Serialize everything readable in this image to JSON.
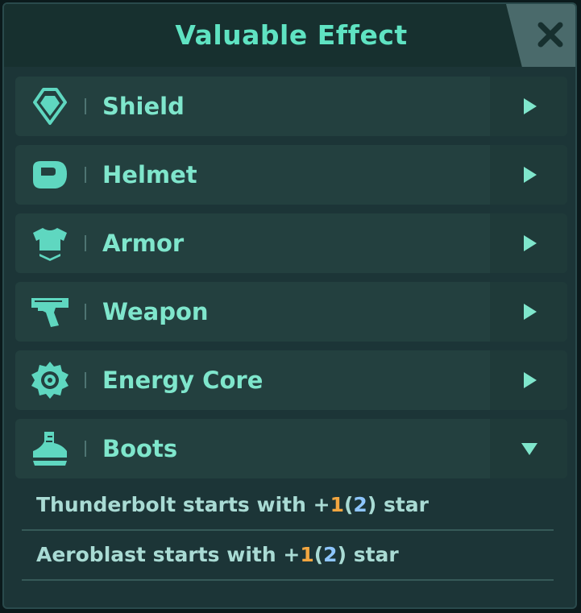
{
  "header": {
    "title": "Valuable Effect"
  },
  "categories": [
    {
      "label": "Shield",
      "icon": "shield-icon",
      "expanded": false
    },
    {
      "label": "Helmet",
      "icon": "helmet-icon",
      "expanded": false
    },
    {
      "label": "Armor",
      "icon": "armor-icon",
      "expanded": false
    },
    {
      "label": "Weapon",
      "icon": "weapon-icon",
      "expanded": false
    },
    {
      "label": "Energy Core",
      "icon": "energy-core-icon",
      "expanded": false
    },
    {
      "label": "Boots",
      "icon": "boots-icon",
      "expanded": true
    }
  ],
  "boots_effects": [
    {
      "prefix": "Thunderbolt starts with +",
      "value": "1",
      "open": "(",
      "alt": "2",
      "close": ")",
      "suffix": " star"
    },
    {
      "prefix": "Aeroblast starts with +",
      "value": "1",
      "open": "(",
      "alt": "2",
      "close": ")",
      "suffix": " star"
    }
  ],
  "colors": {
    "accent": "#5fe3c2",
    "label": "#7fe6cc",
    "highlight_orange": "#f2a640",
    "highlight_blue": "#8ec6ff"
  }
}
